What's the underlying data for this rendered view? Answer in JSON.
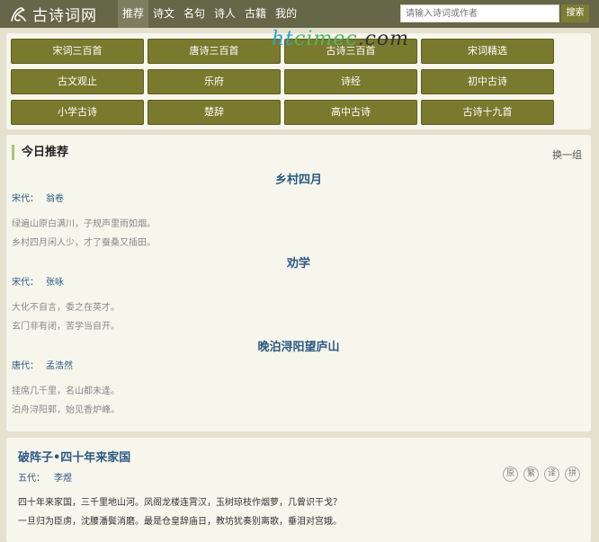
{
  "header": {
    "logo_text": "古诗词网",
    "nav": [
      "推荐",
      "诗文",
      "名句",
      "诗人",
      "古籍",
      "我的"
    ],
    "nav_active": 0,
    "search_placeholder": "请输入诗词或作者",
    "search_button": "搜索"
  },
  "watermark": {
    "part1": "ht",
    "part2": "cimec",
    "part3": ".com"
  },
  "categories": [
    "宋词三百首",
    "唐诗三百首",
    "古诗三百首",
    "宋词精选",
    "古文观止",
    "乐府",
    "诗经",
    "初中古诗",
    "小学古诗",
    "楚辞",
    "高中古诗",
    "古诗十九首"
  ],
  "recommend": {
    "title": "今日推荐",
    "switch": "换一组",
    "poems": [
      {
        "title": "乡村四月",
        "dynasty": "宋代：",
        "author": "翁卷",
        "lines": [
          "绿遍山原白满川，子规声里雨如烟。",
          "乡村四月闲人少，才了蚕桑又插田。"
        ]
      },
      {
        "title": "劝学",
        "dynasty": "宋代：",
        "author": "张咏",
        "lines": [
          "大化不自言，委之在英才。",
          "玄门非有闭，苦学当自开。"
        ]
      },
      {
        "title": "晚泊浔阳望庐山",
        "dynasty": "唐代：",
        "author": "孟浩然",
        "lines": [
          "挂席几千里，名山都未逢。",
          "泊舟浔阳郭，始见香炉峰。"
        ]
      }
    ]
  },
  "featured": {
    "title": "破阵子•四十年来家国",
    "dynasty": "五代：",
    "author": "李煜",
    "tools": [
      "原",
      "繁",
      "译",
      "拼"
    ],
    "lines": [
      "四十年来家国，三千里地山河。凤阁龙楼连霄汉，玉树琼枝作烟萝，几曾识干戈？",
      "一旦归为臣虏，沈腰潘鬓消磨。最是仓皇辞庙日，教坊犹奏别离歌，垂泪对宫娥。"
    ]
  }
}
